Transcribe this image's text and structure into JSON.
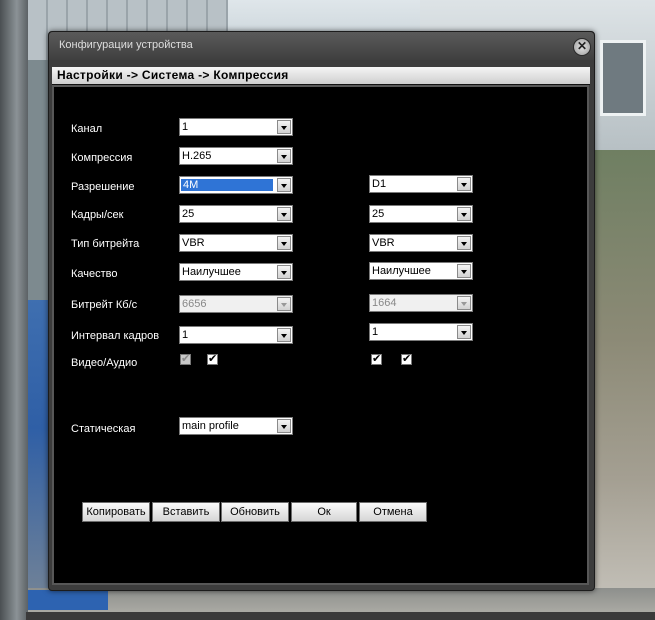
{
  "window": {
    "title": "Конфигурации устройства",
    "close_symbol": "✕"
  },
  "breadcrumb": "Настройки -> Система -> Компрессия",
  "labels": {
    "channel": "Канал",
    "compression": "Компрессия",
    "resolution": "Разрешение",
    "fps": "Кадры/сек",
    "bitrate_type": "Тип битрейта",
    "quality": "Качество",
    "bitrate": "Битрейт Кб/с",
    "frame_interval": "Интервал кадров",
    "video_audio": "Видео/Аудио",
    "static": "Статическая"
  },
  "main_stream": {
    "channel": "1",
    "compression": "H.265",
    "resolution": "4M",
    "fps": "25",
    "bitrate_type": "VBR",
    "quality": "Наилучшее",
    "bitrate": "6656",
    "frame_interval": "1",
    "video_checked": true,
    "audio_checked": true,
    "static": "main profile"
  },
  "extra_stream": {
    "resolution": "D1",
    "fps": "25",
    "bitrate_type": "VBR",
    "quality": "Наилучшее",
    "bitrate": "1664",
    "frame_interval": "1",
    "video_checked": true,
    "audio_checked": true
  },
  "buttons": {
    "copy": "Копировать",
    "paste": "Вставить",
    "refresh": "Обновить",
    "ok": "Ок",
    "cancel": "Отмена"
  },
  "colors": {
    "dialog_bg": "#3c3c3c",
    "content_bg": "#000000",
    "highlight": "#2f74d6"
  }
}
